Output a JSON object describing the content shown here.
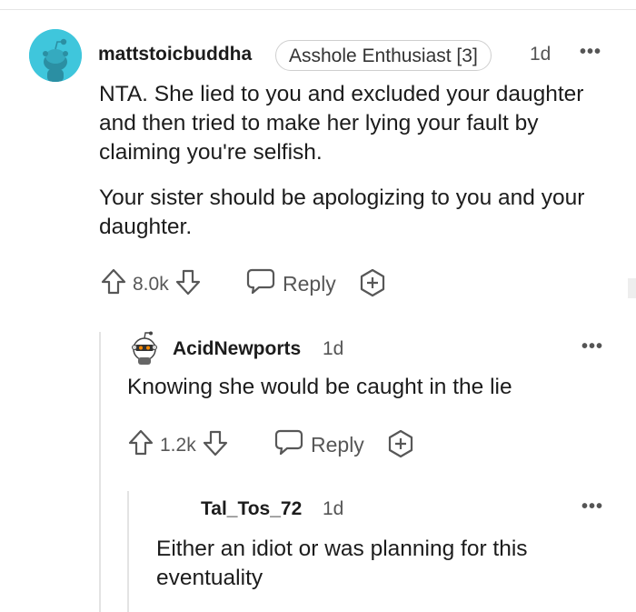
{
  "comments": [
    {
      "username": "mattstoicbuddha",
      "flair": "Asshole Enthusiast [3]",
      "time": "1d",
      "paragraphs": [
        "NTA. She lied to you and excluded your daughter and then tried to make her lying your fault by claiming you're selfish.",
        "Your sister should be apologizing to you and your daughter."
      ],
      "votes": "8.0k",
      "reply_label": "Reply"
    },
    {
      "username": "AcidNewports",
      "time": "1d",
      "text": "Knowing she would be caught in the lie",
      "votes": "1.2k",
      "reply_label": "Reply"
    },
    {
      "username": "Tal_Tos_72",
      "time": "1d",
      "text": "Either an idiot or was planning for this eventuality"
    }
  ],
  "icons": {
    "upvote": "arrow-up-outline",
    "downvote": "arrow-down-outline",
    "reply": "speech-bubble",
    "award": "plus-circle",
    "more": "ellipsis"
  },
  "colors": {
    "avatar_bg": "#3fc6dc",
    "thread_line": "#e3e3e3",
    "text": "#1c1c1c",
    "muted": "#575757"
  }
}
